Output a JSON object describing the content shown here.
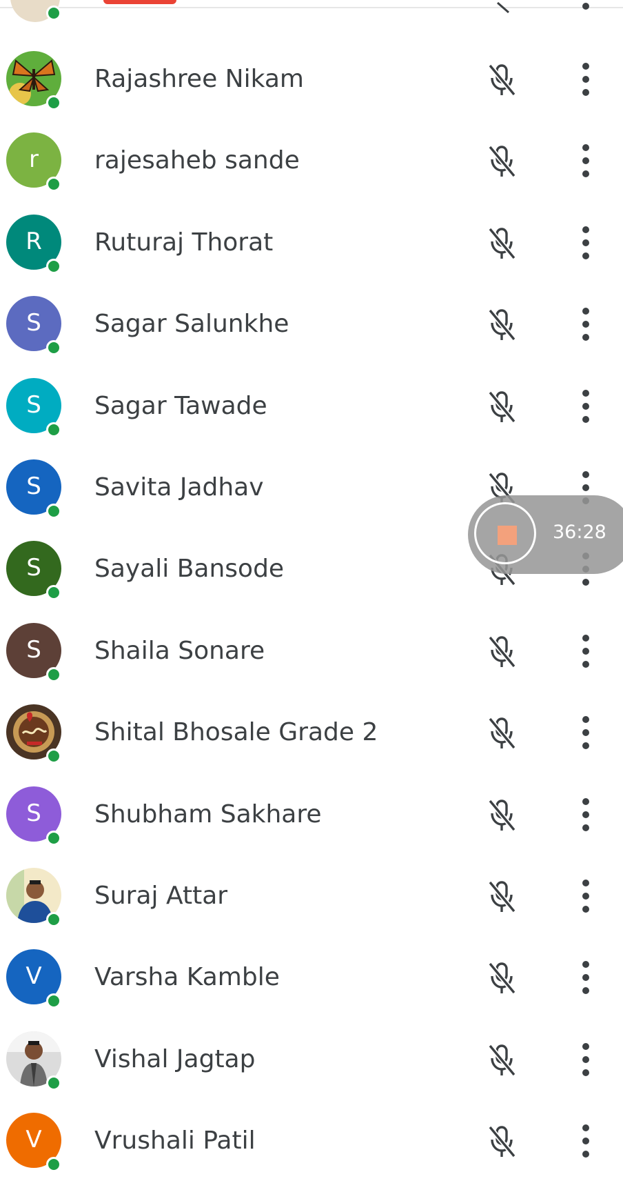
{
  "icons": {
    "mic": "mic-off-icon",
    "more": "more-vert-icon",
    "status": "online-status-dot",
    "stop": "stop-icon"
  },
  "colors": {
    "online": "#1e9e46",
    "text": "#3c4043",
    "accent_red": "#ea4335",
    "recording_stop": "#f3a17c"
  },
  "participants": [
    {
      "name": "Rajashree Nikam",
      "avatar_type": "photo",
      "photo": "butterfly",
      "initial": ""
    },
    {
      "name": "rajesaheb sande",
      "avatar_type": "letter",
      "initial": "r",
      "color": "#7cb342"
    },
    {
      "name": "Ruturaj Thorat",
      "avatar_type": "letter",
      "initial": "R",
      "color": "#00897b"
    },
    {
      "name": "Sagar Salunkhe",
      "avatar_type": "letter",
      "initial": "S",
      "color": "#5c6bc0"
    },
    {
      "name": "Sagar Tawade",
      "avatar_type": "letter",
      "initial": "S",
      "color": "#00acc1"
    },
    {
      "name": "Savita Jadhav",
      "avatar_type": "letter",
      "initial": "S",
      "color": "#1565c0"
    },
    {
      "name": "Sayali Bansode",
      "avatar_type": "letter",
      "initial": "S",
      "color": "#33691e"
    },
    {
      "name": "Shaila Sonare",
      "avatar_type": "letter",
      "initial": "S",
      "color": "#5d4037"
    },
    {
      "name": "Shital Bhosale Grade 2",
      "avatar_type": "photo",
      "photo": "badge",
      "initial": ""
    },
    {
      "name": "Shubham Sakhare",
      "avatar_type": "letter",
      "initial": "S",
      "color": "#8e5cd9"
    },
    {
      "name": "Suraj Attar",
      "avatar_type": "photo",
      "photo": "person-blue",
      "initial": ""
    },
    {
      "name": "Varsha Kamble",
      "avatar_type": "letter",
      "initial": "V",
      "color": "#1565c0"
    },
    {
      "name": "Vishal Jagtap",
      "avatar_type": "photo",
      "photo": "person-grey",
      "initial": ""
    },
    {
      "name": "Vrushali Patil",
      "avatar_type": "letter",
      "initial": "V",
      "color": "#ef6c00"
    }
  ],
  "recording": {
    "elapsed": "36:28"
  }
}
